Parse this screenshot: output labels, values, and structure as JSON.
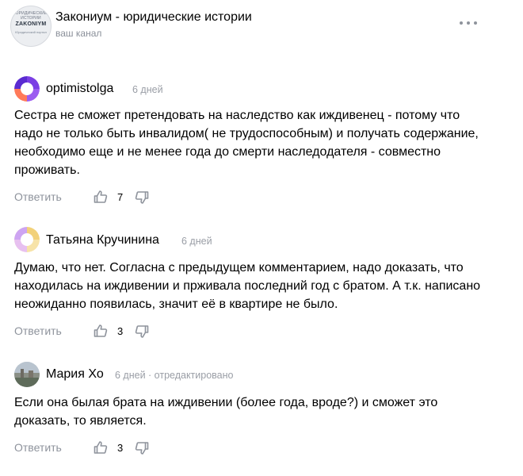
{
  "channel": {
    "logo_ring_text": "ЮРИДИЧЕСКИЕ ИСТОРИИ",
    "logo_name": "ZAKONIYM",
    "logo_caption": "Юридический портал",
    "title": "Закониум - юридические истории",
    "subtitle": "ваш канал"
  },
  "comments": [
    {
      "author": "optimistolga",
      "meta": "6 дней",
      "text": "Сестра не сможет претендовать на наследство как иждивенец - потому что надо не только быть инвалидом( не трудоспособным) и получать содержание, необходимо еще и не менее года до смерти наследодателя - совместно проживать.",
      "reply_label": "Ответить",
      "likes": "7"
    },
    {
      "author": "Татьяна Кручинина",
      "meta": "6 дней",
      "text": "Думаю, что нет. Согласна с предыдущем комментарием, надо доказать, что находилась на иждивении и прживала последний год с братом. А т.к. написано неожиданно появилась, значит её в квартире не было.",
      "reply_label": "Ответить",
      "likes": "3"
    },
    {
      "author": "Мария Хо",
      "meta": "6 дней · отредактировано",
      "text": "Если она былая брата на иждивении (более года, вроде?) и сможет это доказать, то является.",
      "reply_label": "Ответить",
      "likes": "3"
    }
  ],
  "colors": {
    "muted_text": "#8e939c",
    "meta_text": "#9a9ea6",
    "avatar1_accent": "#7b3fe4",
    "avatar2_accent": "#f2d17a",
    "avatar3_sky": "#cfd6dc"
  },
  "icons": [
    "more-icon",
    "thumb-up-icon",
    "thumb-down-icon"
  ]
}
